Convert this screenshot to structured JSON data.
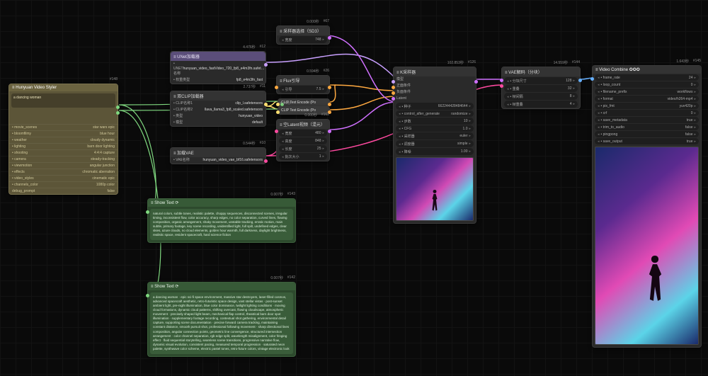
{
  "styler": {
    "id": "#148",
    "title": "≡ Hunyuan Video Styler",
    "prompt": "a dancing woman",
    "params": [
      {
        "k": "• movie_scenes",
        "v": "star wars epic"
      },
      {
        "k": "• bloomfilmy",
        "v": "blue hour"
      },
      {
        "k": "• weather",
        "v": "cloudy dynamic"
      },
      {
        "k": "• lighting",
        "v": "barn door lighting"
      },
      {
        "k": "• shooting",
        "v": "4:4:4 capture"
      },
      {
        "k": "• camera",
        "v": "steady-tracking"
      },
      {
        "k": "• viewmotion",
        "v": "angular junction"
      },
      {
        "k": "• effects",
        "v": "chromatic aberration"
      },
      {
        "k": "• video_styles",
        "v": "cinematic epic"
      },
      {
        "k": "• channels_color",
        "v": "1080p color"
      },
      {
        "k": "debug_prompt",
        "v": "false"
      }
    ]
  },
  "unet": {
    "id": "#12",
    "time": "4.476秒",
    "title": "≡ UNet加载器",
    "rows": [
      {
        "k": "• UNET名称",
        "v": "hunyuan_video_fastVideo_720_fp8_e4m3fn.safet…"
      },
      {
        "k": "• 权重类型",
        "v": "fp8_e4m3fn_fast"
      }
    ]
  },
  "clip2": {
    "id": "#11",
    "time": "2.737秒",
    "title": "≡ 双CLIP加载器",
    "rows": [
      {
        "k": "• CLIP名称1",
        "v": "clip_l.safetensors"
      },
      {
        "k": "• CLIP名称2",
        "v": "llava_llama3_fp8_scaled.safetensors"
      },
      {
        "k": "• 类型",
        "v": "hunyuan_video"
      },
      {
        "k": "• 模型",
        "v": "default"
      }
    ]
  },
  "vae": {
    "id": "#10",
    "time": "0.544秒",
    "title": "≡ 加载VAE",
    "rows": [
      {
        "k": "• VAE名称",
        "v": "hunyuan_video_vae_bf16.safetensors"
      }
    ]
  },
  "latent": {
    "id": "#67",
    "time": "0.000秒",
    "title": "≡ 采样器选择（SD3）",
    "widgets": [
      {
        "k": "宽度",
        "v": "748"
      }
    ]
  },
  "flux": {
    "id": "#26",
    "time": "0.594秒",
    "title": "≡ Flux引导",
    "widgets": [
      {
        "k": "引导",
        "v": "7.5"
      }
    ]
  },
  "clipencP": {
    "id": "",
    "title": "CLIP Text Encode (Po"
  },
  "clipencN": {
    "id": "",
    "time": "0.175秒",
    "title": "CLIP Text Encode (Po"
  },
  "latentimg": {
    "id": "#162",
    "time": "0.000秒",
    "title": "≡ 空Latent视频（混元）",
    "widgets": [
      {
        "k": "宽度",
        "v": "480"
      },
      {
        "k": "高度",
        "v": "848"
      },
      {
        "k": "长度",
        "v": "25"
      },
      {
        "k": "批次大小",
        "v": "1"
      }
    ]
  },
  "ksampler": {
    "id": "#126",
    "time": "102.853秒",
    "title": "≡ K采样器",
    "widgets": [
      {
        "k": "• 种子",
        "v": "662244428484644"
      },
      {
        "k": "• control_after_generate",
        "v": "randomize"
      },
      {
        "k": "• 步数",
        "v": "10"
      },
      {
        "k": "• CFG",
        "v": "1.0"
      },
      {
        "k": "• 采样器",
        "v": "euler"
      },
      {
        "k": "• 调度器",
        "v": "simple"
      },
      {
        "k": "• 降噪",
        "v": "1.00"
      }
    ]
  },
  "vaedecode": {
    "id": "#144",
    "time": "14.559秒",
    "title": "≡ VAE解码（分块）",
    "widgets": [
      {
        "k": "• 分块尺寸",
        "v": "128"
      },
      {
        "k": "• 重叠",
        "v": "32"
      },
      {
        "k": "• 帧间隔",
        "v": "8"
      },
      {
        "k": "• 帧重叠",
        "v": "4"
      }
    ]
  },
  "video": {
    "id": "#145",
    "time": "1.643秒",
    "title": "≡ Video Combine  ✪✪✪",
    "widgets": [
      {
        "k": "• frame_rate",
        "v": "24"
      },
      {
        "k": "• loop_count",
        "v": "0"
      },
      {
        "k": "• filename_prefix",
        "v": "workflows"
      },
      {
        "k": "• format",
        "v": "video/h264-mp4"
      },
      {
        "k": "• pix_fmt",
        "v": "yuv420p"
      },
      {
        "k": "• crf",
        "v": "0"
      },
      {
        "k": "• save_metadata",
        "v": "true"
      },
      {
        "k": "• trim_to_audio",
        "v": "false"
      },
      {
        "k": "• pingpong",
        "v": "false"
      },
      {
        "k": "• save_output",
        "v": "true"
      }
    ]
  },
  "show1": {
    "id": "#143",
    "time": "0.007秒",
    "title": "≡ Show Text ⟳",
    "body": "natural colors, subtle tones, realistic palette, choppy sequences, disconnected scenes, irregular timing, inconsistent flow, color accuracy, sharp edges, no color separation, curved lines, flowing composition, organic arrangement, shaky movement, unstable tracking, erratic motion, main subtle, primary footage, key scene recording, unidentified light, full spill, undefined edges, clear skies, azure clouds, no cloud elements, golden hour warmth, full darkness, daylight brightness, realistic space, resident spacecraft, hard science fiction"
  },
  "show2": {
    "id": "#142",
    "time": "0.007秒",
    "title": "≡ Show Text ⟳",
    "body": "a dancing woman · epic sci-fi space environment, massive star destroyers, laser-filled cosmos, advanced spacecraft aesthetic, retro-futuristic space design, vast stellar vistas · post-sunset ambient light, pre-night illumination, blue color dominance, twilight lighting conditions · moving cloud formations, dynamic cloud patterns, shifting overcast, flowing cloudscape, atmospheric movement · precisely shaped light beam, mechanical flap control, theatrical barn door spot illumination · supplementary footage recording, contextual shot gathering, environmental detail capture, supporting scene documentation · precise forward camera tracking, maintaining constant distance, smooth pursuit shot, professional following movement · sharp directional lines composition, angular connection points, geometric line convergence, structured intersection arrangement · color channel separation, rgb edge split, wavelength misalignment, color fringing effect · fluid sequential storytelling, seamless scene transitions, progressive narrative flow, dynamic visual evolution, consistent pacing, measured temporal progression · saturated neon palette, synthwave color scheme, electric pastel tones, retro-future colors, vintage electronic look"
  },
  "colors": {
    "model": "#c9a0ff",
    "clip": "#ffe070",
    "cond": "#ffa940",
    "vae": "#ff4aa0",
    "latent": "#d070ff",
    "image": "#66b0ff",
    "string": "#7fd87f"
  }
}
